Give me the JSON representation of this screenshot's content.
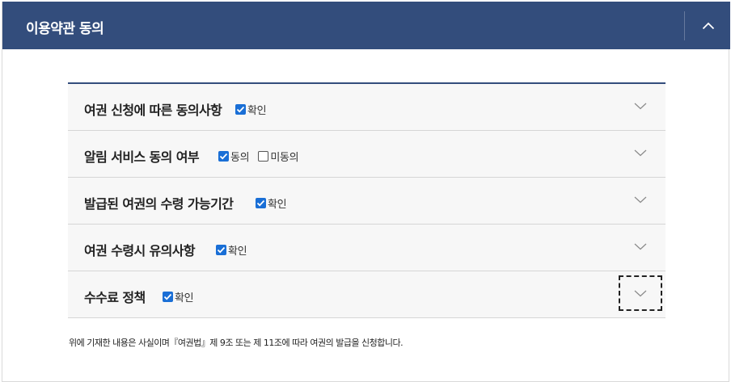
{
  "header": {
    "title": "이용약관 동의",
    "bg_color": "#334d7c",
    "toggle_icon": "chevron-up-icon"
  },
  "sections": [
    {
      "title": "여권 신청에 따른 동의사항",
      "options": [
        {
          "label": "확인",
          "checked": true
        }
      ],
      "focused": false
    },
    {
      "title": "알림 서비스 동의 여부",
      "options": [
        {
          "label": "동의",
          "checked": true
        },
        {
          "label": "미동의",
          "checked": false
        }
      ],
      "focused": false
    },
    {
      "title": "발급된 여권의 수령 가능기간",
      "options": [
        {
          "label": "확인",
          "checked": true
        }
      ],
      "focused": false
    },
    {
      "title": "여권 수령시 유의사항",
      "options": [
        {
          "label": "확인",
          "checked": true
        }
      ],
      "focused": false
    },
    {
      "title": "수수료 정책",
      "options": [
        {
          "label": "확인",
          "checked": true
        }
      ],
      "focused": true
    }
  ],
  "footnote": "위에 기재한 내용은 사실이며『여권법』제 9조 또는 제 11조에 따라 여권의 발급을 신청합니다.",
  "colors": {
    "checkbox": "#1a6fd6",
    "row_bg": "#f7f7f7",
    "list_top_border": "#334d7c"
  }
}
